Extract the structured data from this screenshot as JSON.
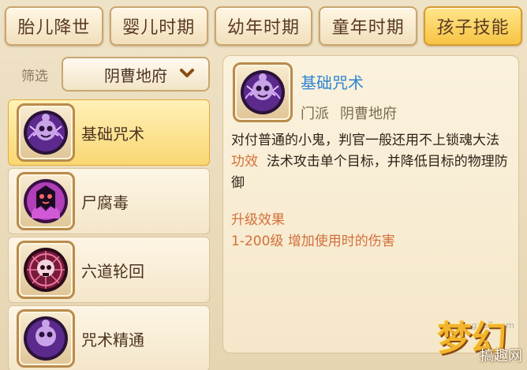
{
  "tabs": [
    {
      "label": "胎儿降世",
      "active": false
    },
    {
      "label": "婴儿时期",
      "active": false
    },
    {
      "label": "幼年时期",
      "active": false
    },
    {
      "label": "童年时期",
      "active": false
    },
    {
      "label": "孩子技能",
      "active": true
    }
  ],
  "filter": {
    "label": "筛选",
    "selected": "阴曹地府",
    "icon": "chevron-down-icon"
  },
  "skills": [
    {
      "name": "基础咒术",
      "icon": "ghost-spell-icon",
      "selected": true
    },
    {
      "name": "尸腐毒",
      "icon": "poison-ghost-icon",
      "selected": false
    },
    {
      "name": "六道轮回",
      "icon": "skull-wheel-icon",
      "selected": false
    },
    {
      "name": "咒术精通",
      "icon": "ghost-spell-icon",
      "selected": false
    }
  ],
  "detail": {
    "title": "基础咒术",
    "sect_label": "门派",
    "sect_value": "阴曹地府",
    "description": "对付普通的小鬼，判官一般还用不上锁魂大法",
    "effect_label": "功效",
    "effect_text": "法术攻击单个目标，并降低目标的物理防御",
    "upgrade_title": "升级效果",
    "upgrade_level": "1-200级",
    "upgrade_text": "增加使用时的伤害"
  },
  "watermark": {
    "logo": "梦幻",
    "url": "gao7.com",
    "site": "搞趣网"
  },
  "colors": {
    "active_tab": "#f7c444",
    "title_blue": "#2e84d2",
    "accent_orange": "#d2703a"
  }
}
